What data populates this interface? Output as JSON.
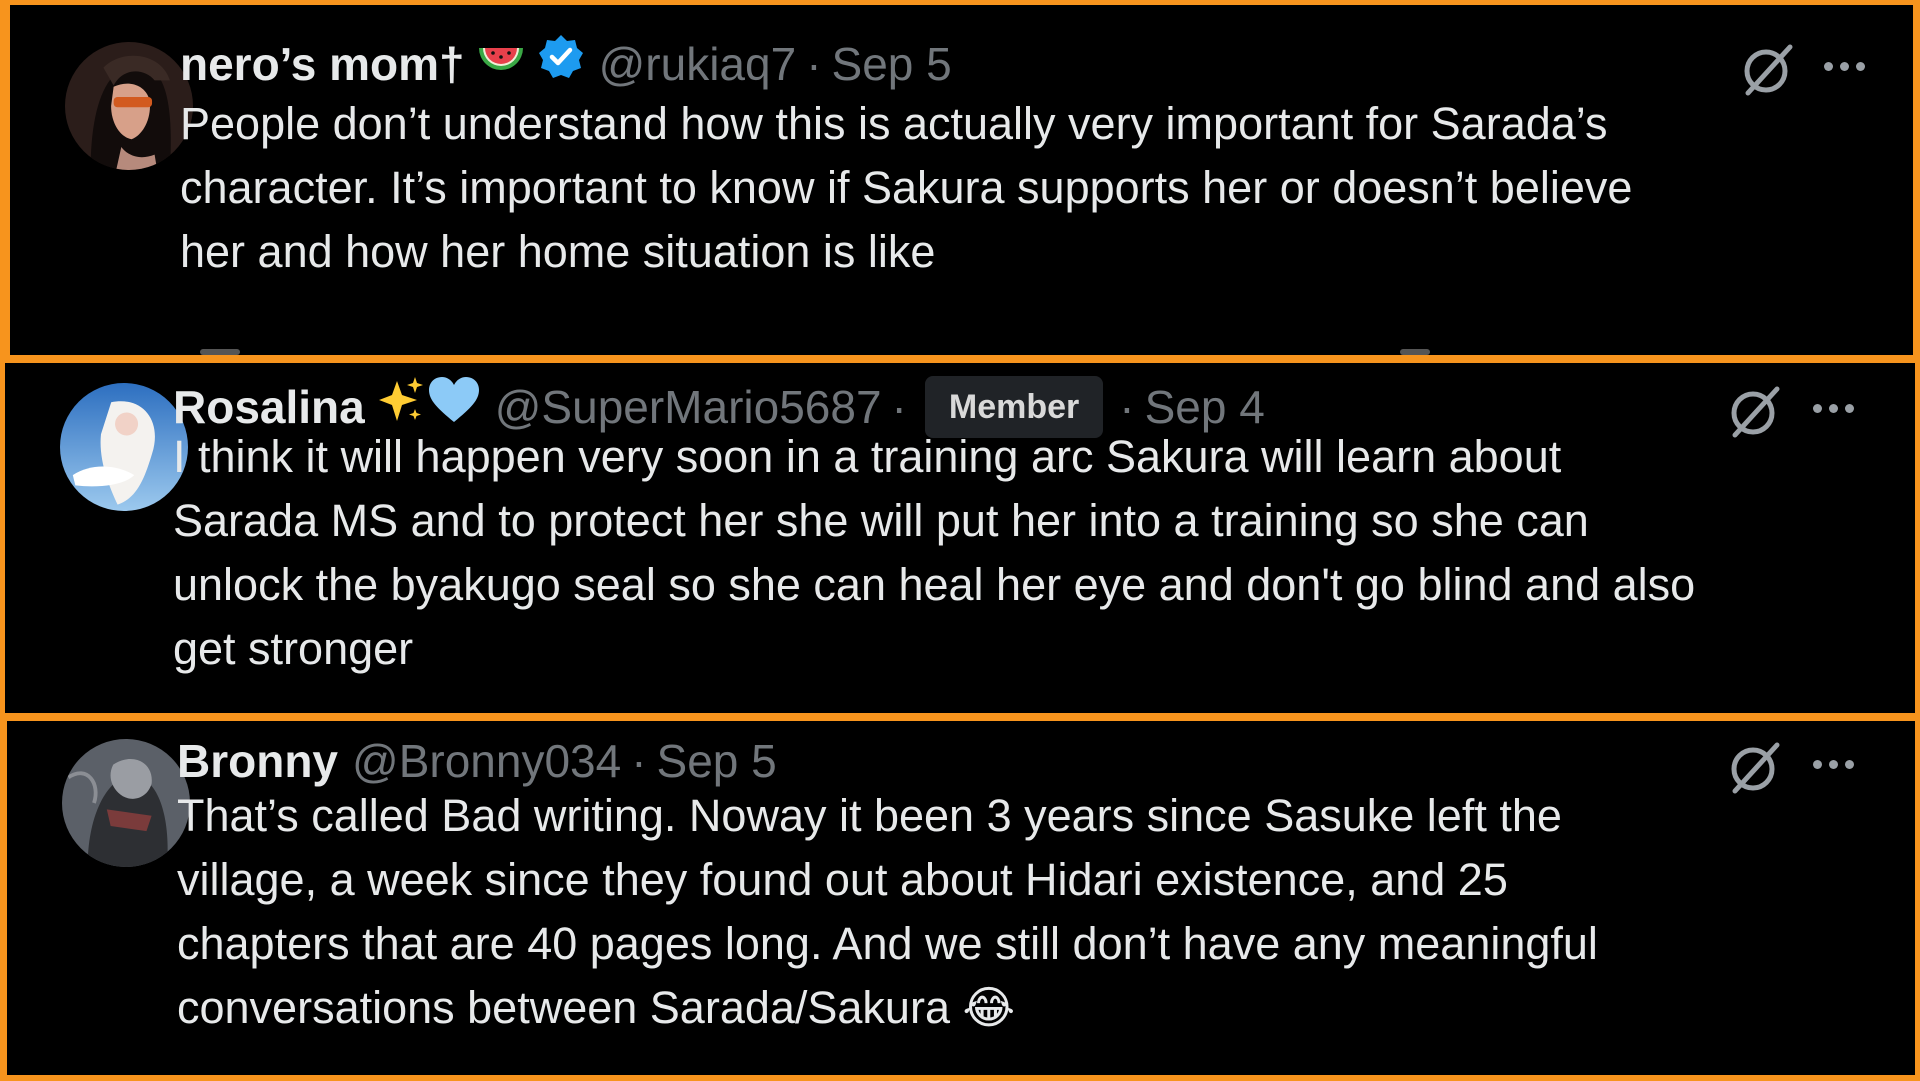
{
  "colors": {
    "frame_border": "#f7941d",
    "background": "#000000",
    "text_primary": "#e7e9ea",
    "text_secondary": "#71767b",
    "verified_blue": "#1d9bf0"
  },
  "tweets": [
    {
      "display_name": "nero’s mom†",
      "name_emojis": [
        "watermelon",
        "verified-badge"
      ],
      "handle": "@rukiaq7",
      "separator": "·",
      "date": "Sep 5",
      "text": "People don’t understand how this is actually very important for Sarada’s\ncharacter. It’s important to know if Sakura supports her or doesn’t believe\nher and how her home situation is like",
      "icons": [
        "grok-icon",
        "more-icon"
      ]
    },
    {
      "display_name": "Rosalina",
      "name_emojis": [
        "sparkles",
        "light-blue-heart"
      ],
      "handle": "@SuperMario5687",
      "separator": "·",
      "badge": "Member",
      "date": "Sep 4",
      "text": "I think it will happen very soon in a training arc Sakura will learn about\nSarada MS and to protect her she will put her into a training so she can\nunlock the byakugo seal so she can heal her eye and don't go blind and also\nget stronger",
      "icons": [
        "grok-icon",
        "more-icon"
      ]
    },
    {
      "display_name": "Bronny",
      "handle": "@Bronny034",
      "separator": "·",
      "date": "Sep 5",
      "text": "That’s called Bad writing. Noway it been 3 years since Sasuke left the\nvillage, a week since they found out about Hidari existence, and 25\nchapters that are 40 pages long. And we still don’t have any meaningful\nconversations between Sarada/Sakura 😂",
      "icons": [
        "grok-icon",
        "more-icon"
      ]
    }
  ]
}
